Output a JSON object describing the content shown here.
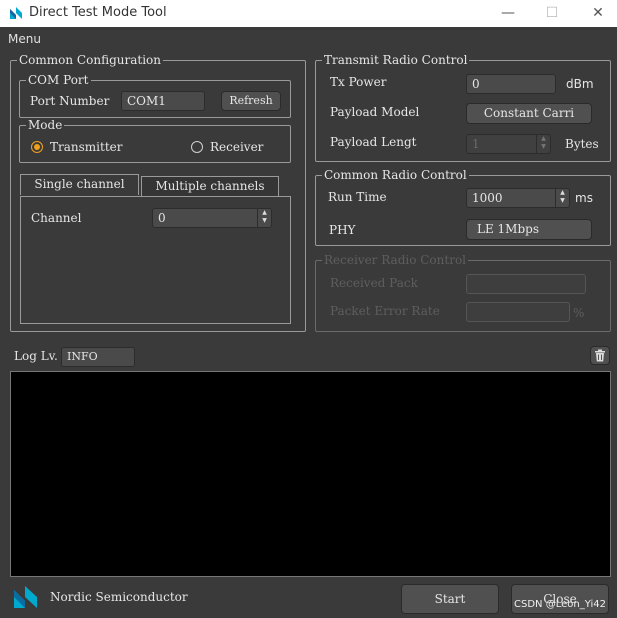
{
  "window": {
    "title": "Direct Test Mode Tool",
    "minimize_glyph": "—",
    "maximize_glyph": "☐",
    "close_glyph": "✕"
  },
  "menu": {
    "label": "Menu"
  },
  "common_config": {
    "title": "Common Configuration",
    "com_port": {
      "title": "COM Port",
      "port_label": "Port Number",
      "port_value": "COM1",
      "refresh_label": "Refresh"
    },
    "mode": {
      "title": "Mode",
      "transmitter_label": "Transmitter",
      "receiver_label": "Receiver",
      "selected": "Transmitter"
    },
    "tabs": {
      "single_label": "Single channel",
      "multiple_label": "Multiple channels",
      "active": "Single channel"
    },
    "channel": {
      "label": "Channel",
      "value": "0"
    }
  },
  "transmit": {
    "title": "Transmit Radio Control",
    "tx_power_label": "Tx Power",
    "tx_power_value": "0",
    "tx_power_unit": "dBm",
    "payload_model_label": "Payload Model",
    "payload_model_value": "Constant Carri",
    "payload_length_label": "Payload Lengt",
    "payload_length_value": "1",
    "payload_length_unit": "Bytes"
  },
  "common_radio": {
    "title": "Common Radio Control",
    "run_time_label": "Run Time",
    "run_time_value": "1000",
    "run_time_unit": "ms",
    "phy_label": "PHY",
    "phy_value": "LE 1Mbps"
  },
  "receiver": {
    "title": "Receiver Radio Control",
    "received_label": "Received Pack",
    "received_value": "",
    "per_label": "Packet Error Rate",
    "per_value": "",
    "per_unit": "%"
  },
  "log": {
    "level_label": "Log Lv.",
    "level_value": "INFO",
    "clear_icon": "trash-icon"
  },
  "footer": {
    "brand": "Nordic Semiconductor",
    "start_label": "Start",
    "close_label": "Close",
    "watermark": "CSDN @Leon_Yi42"
  },
  "colors": {
    "background": "#3a3a3a",
    "accent": "#f0a020",
    "nordic_blue": "#00a9ce",
    "log_background": "#000000"
  }
}
